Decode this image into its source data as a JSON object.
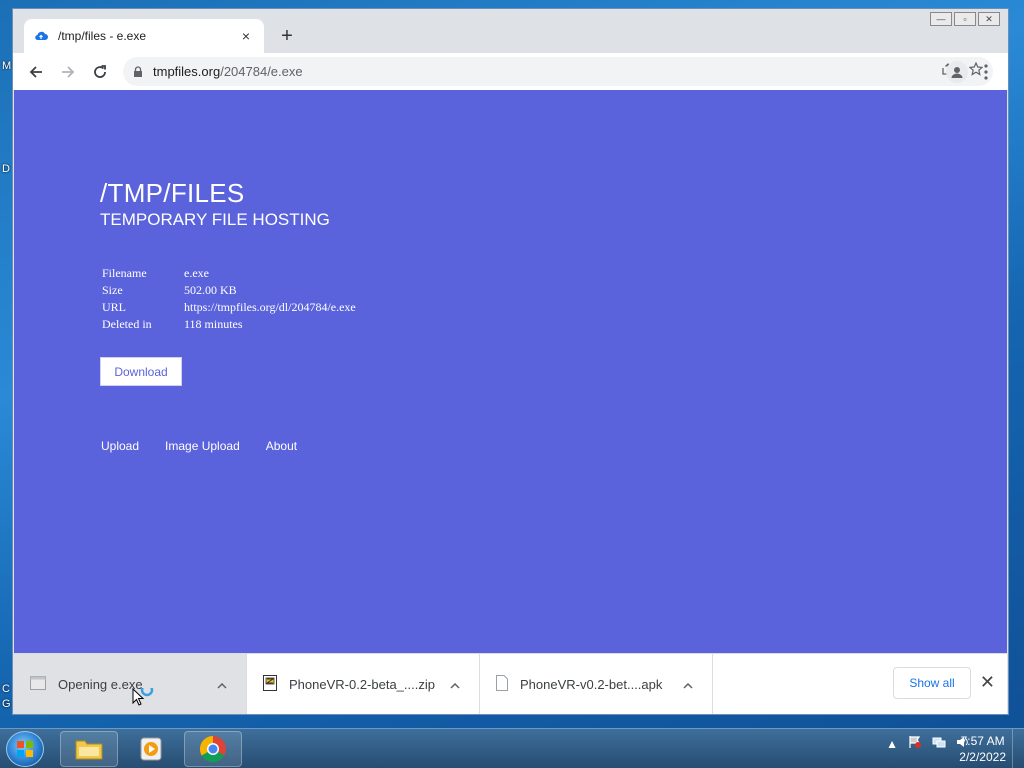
{
  "desktop": {
    "fragments": [
      "M",
      "D",
      "C",
      "G"
    ]
  },
  "browser": {
    "tab": {
      "title": "/tmp/files - e.exe",
      "close": "×"
    },
    "new_tab": "+",
    "url": {
      "domain": "tmpfiles.org",
      "path": "/204784/e.exe"
    }
  },
  "page": {
    "title": "/TMP/FILES",
    "subtitle": "TEMPORARY FILE HOSTING",
    "info": [
      {
        "key": "Filename",
        "value": "e.exe"
      },
      {
        "key": "Size",
        "value": "502.00 KB"
      },
      {
        "key": "URL",
        "value": "https://tmpfiles.org/dl/204784/e.exe"
      },
      {
        "key": "Deleted in",
        "value": "118 minutes"
      }
    ],
    "download_label": "Download",
    "links": [
      "Upload",
      "Image Upload",
      "About"
    ]
  },
  "shelf": {
    "items": [
      {
        "name": "Opening e.exe",
        "icon": "exe-file-icon"
      },
      {
        "name": "PhoneVR-0.2-beta_....zip",
        "icon": "zip-archive-icon"
      },
      {
        "name": "PhoneVR-v0.2-bet....apk",
        "icon": "file-icon"
      }
    ],
    "show_all": "Show all",
    "close": "✕"
  },
  "taskbar": {
    "time": "7:57 AM",
    "date": "2/2/2022"
  },
  "colors": {
    "page_bg": "#5b63dc",
    "link_blue": "#1a73e8"
  }
}
